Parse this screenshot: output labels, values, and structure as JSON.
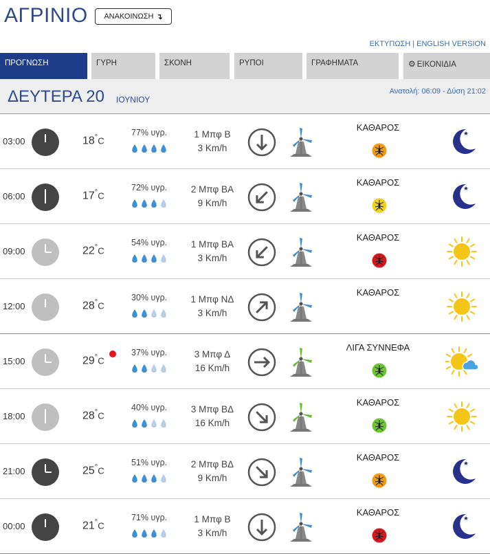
{
  "header": {
    "city": "ΑΓΡΙΝΙΟ",
    "announce_label": "ΑΝΑΚΟΙΝΩΣΗ",
    "announce_arrow": "↴",
    "print_link": "ΕΚΤΥΠΩΣΗ",
    "link_separator": "|",
    "english_link": "ENGLISH VERSION"
  },
  "tabs": [
    {
      "label": "ΠΡΟΓΝΩΣΗ",
      "active": true
    },
    {
      "label": "ΓΥΡΗ",
      "active": false
    },
    {
      "label": "ΣΚΟΝΗ",
      "active": false
    },
    {
      "label": "ΡΥΠΟΙ",
      "active": false
    },
    {
      "label": "ΓΡΑΦΗΜΑΤΑ",
      "active": false
    },
    {
      "label": "ΕΙΚΟΝΙΔΙΑ",
      "icon": "gear-icon",
      "active": false
    }
  ],
  "day": {
    "name": "ΔΕΥΤΕΡΑ 20",
    "month": "ΙΟΥΝΙΟΥ",
    "sun_times": "Ανατολή: 06:09  - Δύση 21:02"
  },
  "colors": {
    "brand_blue": "#2e4a8c",
    "tab_active": "#1d3d8a",
    "drop_on": "#3d8fd6",
    "drop_off": "#b9cde0",
    "clock_dark": "#444444",
    "clock_light": "#bfbfbf",
    "moon": "#27318b",
    "sun": "#f5c518",
    "hot_marker": "#e8121c"
  },
  "forecast": [
    {
      "time": "03:00",
      "clock": "night",
      "temp": "18",
      "hum": "77% υγρ.",
      "drops": 4,
      "wind_bf": "1 Μπφ Β",
      "wind_kmh": "3 Km/h",
      "wind_dir": "arrow-south",
      "turbine": "blue",
      "sky": "ΚΑΘΑΡΟΣ",
      "mosquito": "orange",
      "icon": "moon-icon"
    },
    {
      "time": "06:00",
      "clock": "night",
      "temp": "17",
      "hum": "72% υγρ.",
      "drops": 3,
      "wind_bf": "2 Μπφ ΒΑ",
      "wind_kmh": "9 Km/h",
      "wind_dir": "arrow-southwest",
      "turbine": "blue",
      "sky": "ΚΑΘΑΡΟΣ",
      "mosquito": "yellow",
      "icon": "moon-icon"
    },
    {
      "time": "09:00",
      "clock": "day",
      "temp": "22",
      "hum": "54% υγρ.",
      "drops": 3,
      "wind_bf": "1 Μπφ ΒΑ",
      "wind_kmh": "3 Km/h",
      "wind_dir": "arrow-southwest",
      "turbine": "blue",
      "sky": "ΚΑΘΑΡΟΣ",
      "mosquito": "red",
      "icon": "sun-icon"
    },
    {
      "time": "12:00",
      "clock": "day",
      "temp": "28",
      "hum": "30% υγρ.",
      "drops": 2,
      "wind_bf": "1 Μπφ ΝΔ",
      "wind_kmh": "3 Km/h",
      "wind_dir": "arrow-northeast",
      "turbine": "blue",
      "sky": "ΚΑΘΑΡΟΣ",
      "mosquito": "",
      "icon": "sun-icon"
    },
    {
      "time": "15:00",
      "clock": "day",
      "temp": "29",
      "hum": "37% υγρ.",
      "drops": 2,
      "wind_bf": "3 Μπφ Δ",
      "wind_kmh": "16 Km/h",
      "wind_dir": "arrow-east",
      "turbine": "green",
      "sky": "ΛΙΓΑ ΣΥΝΝΕΦΑ",
      "mosquito": "green",
      "icon": "sun-cloud-icon",
      "hot": true
    },
    {
      "time": "18:00",
      "clock": "day",
      "temp": "28",
      "hum": "40% υγρ.",
      "drops": 2,
      "wind_bf": "3 Μπφ ΒΔ",
      "wind_kmh": "16 Km/h",
      "wind_dir": "arrow-southeast",
      "turbine": "green",
      "sky": "ΚΑΘΑΡΟΣ",
      "mosquito": "green",
      "icon": "sun-icon"
    },
    {
      "time": "21:00",
      "clock": "night",
      "temp": "25",
      "hum": "51% υγρ.",
      "drops": 3,
      "wind_bf": "2 Μπφ ΒΔ",
      "wind_kmh": "9 Km/h",
      "wind_dir": "arrow-southeast",
      "turbine": "blue",
      "sky": "ΚΑΘΑΡΟΣ",
      "mosquito": "orange",
      "icon": "moon-icon"
    },
    {
      "time": "00:00",
      "clock": "night",
      "temp": "21",
      "hum": "71% υγρ.",
      "drops": 3,
      "wind_bf": "1 Μπφ Β",
      "wind_kmh": "3 Km/h",
      "wind_dir": "arrow-south",
      "turbine": "blue",
      "sky": "ΚΑΘΑΡΟΣ",
      "mosquito": "red",
      "icon": "moon-icon"
    }
  ],
  "units": {
    "degree": "°",
    "celsius": "C"
  }
}
